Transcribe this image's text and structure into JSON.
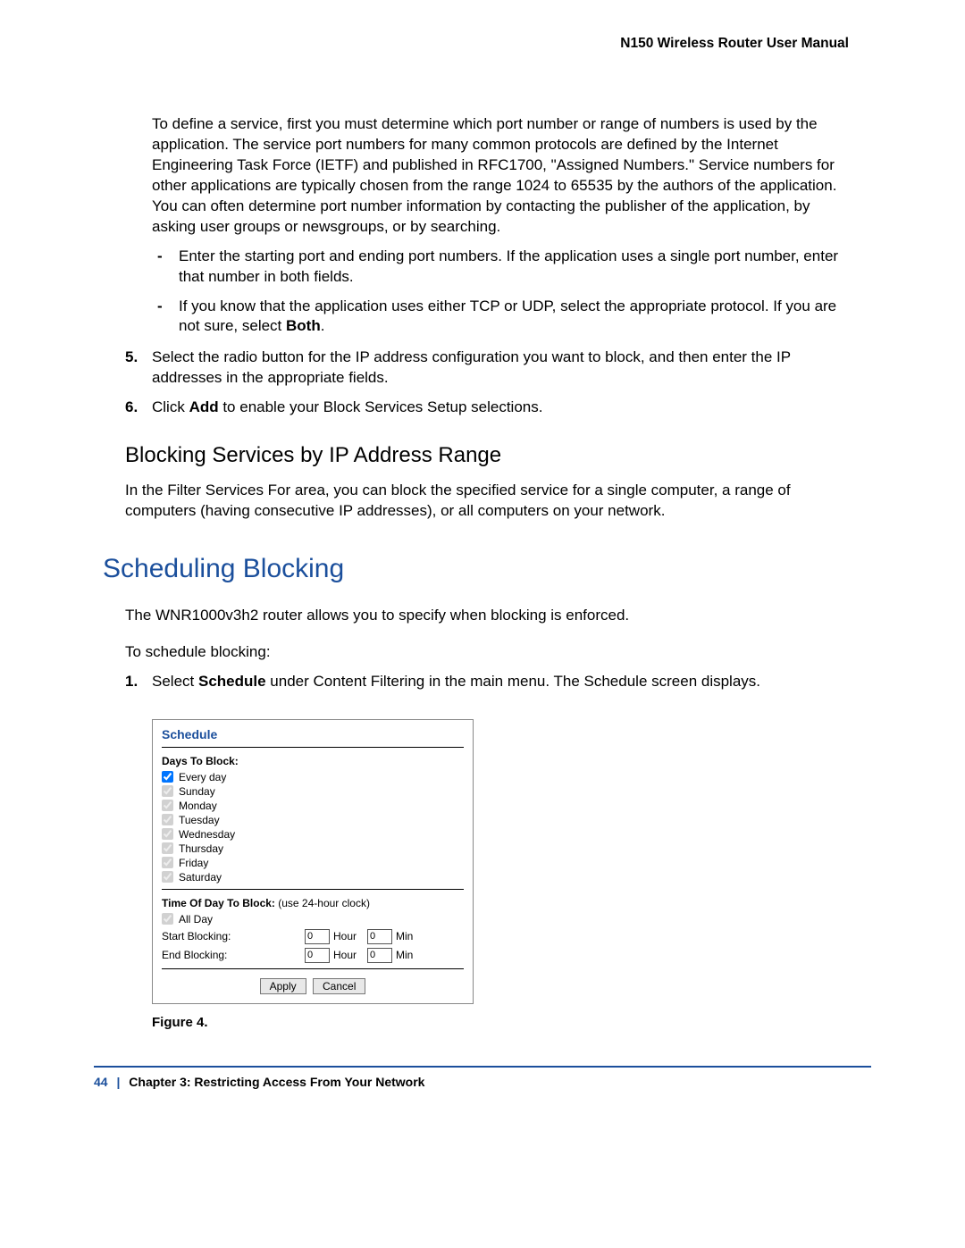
{
  "header": {
    "title": "N150 Wireless Router User Manual"
  },
  "body": {
    "intro": "To define a service, first you must determine which port number or range of numbers is used by the application. The service port numbers for many common protocols are defined by the Internet Engineering Task Force (IETF) and published in RFC1700, \"Assigned Numbers.\" Service numbers for other applications are typically chosen from the range 1024 to 65535 by the authors of the application. You can often determine port number information by contacting the publisher of the application, by asking user groups or newsgroups, or by searching.",
    "bullets": {
      "b1": "Enter the starting port and ending port numbers. If the application uses a single port number, enter that number in both fields.",
      "b2_a": "If you know that the application uses either TCP or UDP, select the appropriate protocol. If you are not sure, select ",
      "b2_bold": "Both",
      "b2_c": "."
    },
    "steps": {
      "s5_num": "5.",
      "s5": "Select the radio button for the IP address configuration you want to block, and then enter the IP addresses in the appropriate fields.",
      "s6_num": "6.",
      "s6_a": "Click ",
      "s6_bold": "Add",
      "s6_c": " to enable your Block Services Setup selections."
    },
    "subhead1": "Blocking Services by IP Address Range",
    "sub1_para": "In the Filter Services For area, you can block the specified service for a single computer, a range of computers (having consecutive IP addresses), or all computers on your network.",
    "mainhead": "Scheduling Blocking",
    "main_p1": "The WNR1000v3h2 router allows you to specify when blocking is enforced.",
    "main_p2": "To schedule blocking:",
    "sched_step_num": "1.",
    "sched_step_a": "Select ",
    "sched_step_bold": "Schedule",
    "sched_step_c": " under Content Filtering in the main menu. The Schedule screen displays.",
    "figcap": "Figure 4."
  },
  "schedule": {
    "title": "Schedule",
    "days_label": "Days To Block:",
    "days": {
      "every": "Every day",
      "sun": "Sunday",
      "mon": "Monday",
      "tue": "Tuesday",
      "wed": "Wednesday",
      "thu": "Thursday",
      "fri": "Friday",
      "sat": "Saturday"
    },
    "time_header_a": "Time Of Day To Block:",
    "time_header_note": " (use 24-hour clock)",
    "all_day": "All Day",
    "start_label": "Start Blocking:",
    "end_label": "End Blocking:",
    "hour_unit": "Hour",
    "min_unit": "Min",
    "values": {
      "start_hour": "0",
      "start_min": "0",
      "end_hour": "0",
      "end_min": "0"
    },
    "buttons": {
      "apply": "Apply",
      "cancel": "Cancel"
    }
  },
  "footer": {
    "page": "44",
    "sep": "|",
    "chapter": "Chapter 3:  Restricting Access From Your Network"
  }
}
